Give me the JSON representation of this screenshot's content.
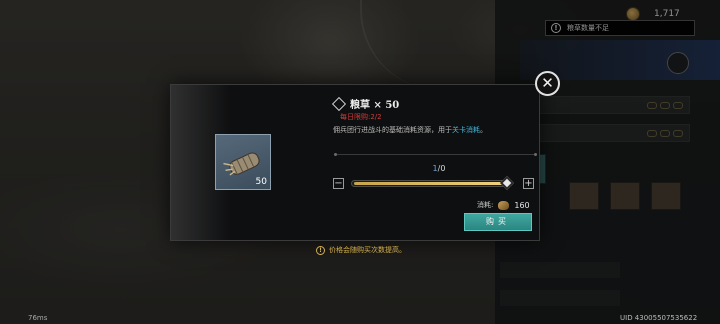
{
  "top_bar": {
    "coin_value": "1,717",
    "icon": "coin-icon"
  },
  "toast": {
    "text": "粮草数量不足",
    "icon": "warning-icon"
  },
  "modal": {
    "item_name": "粮草 × 50",
    "item_quantity": "50",
    "daily_limit": "每日限购:2/2",
    "description_prefix": "佣兵团行进战斗的基础消耗资源，用于",
    "description_link": "关卡消耗",
    "description_suffix": "。",
    "count_current": "1",
    "count_max": "/0",
    "slider_fraction": 0.96,
    "minus_label": "−",
    "plus_label": "+",
    "cost_label": "消耗:",
    "cost_value": "160",
    "buy_label": "购买",
    "close_label": "✕"
  },
  "hint": {
    "text": "价格会随购买次数提高。"
  },
  "footer": {
    "ping": "76ms",
    "uid": "UID 43005507535622"
  },
  "colors": {
    "accent": "#3fa7a0",
    "warning": "#d23a3a",
    "link": "#47b3d6",
    "hint": "#d5b14c"
  }
}
